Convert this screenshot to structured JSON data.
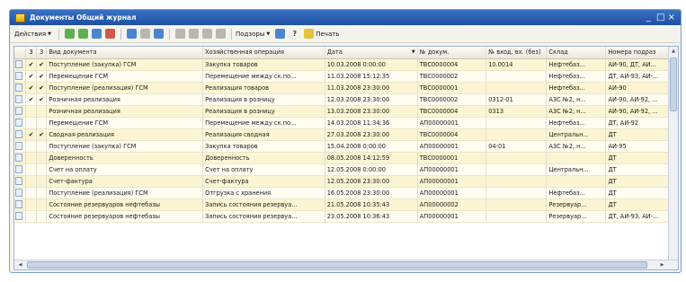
{
  "window": {
    "title": "Документы Общий журнал",
    "minimize": "_",
    "close": "□ ×"
  },
  "toolbar": {
    "actions_label": "Действия",
    "print_label": "Печать",
    "reports_label": "Подзоры",
    "help_label": "?"
  },
  "grid": {
    "columns": {
      "col2": "3",
      "col3": "3",
      "kind": "Вид документа",
      "op": "Хозяйственная операция",
      "date": "Дата",
      "num": "№ докум.",
      "in_num": "№ вход. вх. (без)",
      "wh": "Склад",
      "acct": "Номера подраз"
    },
    "rows": [
      {
        "c2": "✔",
        "c3": "✔",
        "kind": "Поступление (закупка) ГСМ",
        "op": "Закупка товаров",
        "date": "10.03.2008 0:00:00",
        "num": "ТВС0000004",
        "in": "10.0014",
        "wh": "Нефтебаз...",
        "ac": "АИ-90, ДТ, АИ..."
      },
      {
        "c2": "✔",
        "c3": "✔",
        "kind": "Перемещение ГСМ",
        "op": "Перемещение между ск.по...",
        "date": "11.03.2008 15:12:35",
        "num": "ТВС0000002",
        "in": "",
        "wh": "Нефтебаз...",
        "ac": "ДТ, АИ-93, АИ-..."
      },
      {
        "c2": "✔",
        "c3": "✔",
        "kind": "Поступление (реализация) ГСМ",
        "op": "Реализация товаров",
        "date": "11.03.2008 23:30:00",
        "num": "ТВС0000001",
        "in": "",
        "wh": "Нефтебаз...",
        "ac": "АИ-90"
      },
      {
        "c2": "✔",
        "c3": "✔",
        "kind": "Розничная реализация",
        "op": "Реализация в розницу",
        "date": "12.03.2008 23:30:00",
        "num": "ТВС0000002",
        "in": "0312-01",
        "wh": "АЗС №2, н...",
        "ac": "АИ-90, АИ-92, ..."
      },
      {
        "c2": "",
        "c3": "",
        "kind": "Розничная реализация",
        "op": "Реализация в розницу",
        "date": "13.03.2008 23:30:00",
        "num": "ТВС0000004",
        "in": "0313",
        "wh": "АЗС №2, н...",
        "ac": "АИ-90, АИ-92, ..."
      },
      {
        "c2": "",
        "c3": "",
        "kind": "Перемещение ГСМ",
        "op": "Перемещение между ск.по...",
        "date": "14.03.2008 11:34:36",
        "num": "АП00000001",
        "in": "",
        "wh": "Нефтебаз...",
        "ac": "ДТ, АИ-92"
      },
      {
        "c2": "✔",
        "c3": "✔",
        "kind": "Сводная реализация",
        "op": "Реализация сводная",
        "date": "27.03.2008 23:30:00",
        "num": "ТВС0000004",
        "in": "",
        "wh": "Центральн...",
        "ac": "ДТ"
      },
      {
        "c2": "",
        "c3": "",
        "kind": "Поступление (закупка) ГСМ",
        "op": "Закупка товаров",
        "date": "15.04.2008 0:00:00",
        "num": "АП00000001",
        "in": "04-01",
        "wh": "АЗС №2, н...",
        "ac": "АИ-95"
      },
      {
        "c2": "",
        "c3": "",
        "kind": "Доверенность",
        "op": "Доверенность",
        "date": "08.05.2008 14:12:59",
        "num": "ТВС0000001",
        "in": "",
        "wh": "",
        "ac": "ДТ"
      },
      {
        "c2": "",
        "c3": "",
        "kind": "Счет на оплату",
        "op": "Счет на оплату",
        "date": "12.05.2008 0:00:00",
        "num": "АП00000001",
        "in": "",
        "wh": "Центральн...",
        "ac": "ДТ"
      },
      {
        "c2": "",
        "c3": "",
        "kind": "Счет-фактура",
        "op": "Счет-фактура",
        "date": "12.05.2008 23:30:00",
        "num": "АП00000001",
        "in": "",
        "wh": "",
        "ac": "ДТ"
      },
      {
        "c2": "",
        "c3": "",
        "kind": "Поступление (реализация) ГСМ",
        "op": "Отгрузка с хранения",
        "date": "16.05.2008 23:30:00",
        "num": "АП00000001",
        "in": "",
        "wh": "Нефтебаз...",
        "ac": "ДТ"
      },
      {
        "c2": "",
        "c3": "",
        "kind": "Состояние резервуаров нефтебазы",
        "op": "Запись состояния резервуа...",
        "date": "21.05.2008 10:35:43",
        "num": "АП00000002",
        "in": "",
        "wh": "Резервуар...",
        "ac": "ДТ"
      },
      {
        "c2": "",
        "c3": "",
        "kind": "Состояние резервуаров нефтебазы",
        "op": "Запись состояния резервуа...",
        "date": "23.05.2008 10:36:43",
        "num": "АП00000001",
        "in": "",
        "wh": "Резервуар...",
        "ac": "ДТ, АИ-93, АИ-..."
      }
    ]
  }
}
